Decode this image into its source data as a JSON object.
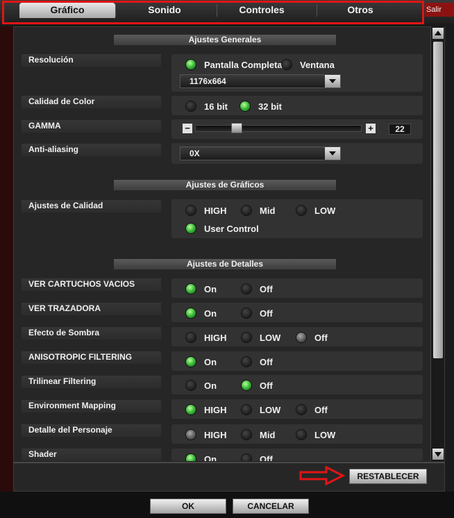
{
  "tabs": [
    {
      "label": "Gráfico",
      "active": true
    },
    {
      "label": "Sonido",
      "active": false
    },
    {
      "label": "Controles",
      "active": false
    },
    {
      "label": "Otros",
      "active": false
    }
  ],
  "exit_label": "Salir",
  "sections": {
    "general": "Ajustes Generales",
    "graphics": "Ajustes de Gráficos",
    "details": "Ajustes de Detalles"
  },
  "settings": {
    "resolution": {
      "label": "Resolución",
      "opt1": "Pantalla Completa",
      "opt2": "Ventana",
      "selected": "Pantalla Completa",
      "dropdown_value": "1176x664"
    },
    "color": {
      "label": "Calidad de Color",
      "opt1": "16 bit",
      "opt2": "32 bit",
      "selected": "32 bit"
    },
    "gamma": {
      "label": "GAMMA",
      "minus": "−",
      "plus": "+",
      "value": "22",
      "level": 0.25
    },
    "aa": {
      "label": "Anti-aliasing",
      "dropdown_value": "0X"
    },
    "quality": {
      "label": "Ajustes de Calidad",
      "opt1": "HIGH",
      "opt2": "Mid",
      "opt3": "LOW",
      "opt4": "User Control",
      "selected": "User Control"
    },
    "empty_shells": {
      "label": "VER CARTUCHOS VACIOS",
      "opt1": "On",
      "opt2": "Off",
      "selected": "On"
    },
    "tracer": {
      "label": "VER TRAZADORA",
      "opt1": "On",
      "opt2": "Off",
      "selected": "On"
    },
    "shadow": {
      "label": "Efecto de Sombra",
      "opt1": "HIGH",
      "opt2": "LOW",
      "opt3": "Off",
      "selected": "Off"
    },
    "aniso": {
      "label": "ANISOTROPIC FILTERING",
      "opt1": "On",
      "opt2": "Off",
      "selected": "On"
    },
    "trilinear": {
      "label": "Trilinear Filtering",
      "opt1": "On",
      "opt2": "Off",
      "selected": "Off"
    },
    "envmap": {
      "label": "Environment Mapping",
      "opt1": "HIGH",
      "opt2": "LOW",
      "opt3": "Off",
      "selected": "HIGH"
    },
    "character": {
      "label": "Detalle del Personaje",
      "opt1": "HIGH",
      "opt2": "Mid",
      "opt3": "LOW",
      "selected": "HIGH"
    },
    "shader": {
      "label": "Shader",
      "opt1": "On",
      "opt2": "Off",
      "selected": "On"
    }
  },
  "buttons": {
    "reset": "RESTABLECER",
    "ok": "OK",
    "cancel": "CANCELAR"
  },
  "colors": {
    "annotation_red": "#e01515",
    "radio_on": "#2fae2f"
  }
}
